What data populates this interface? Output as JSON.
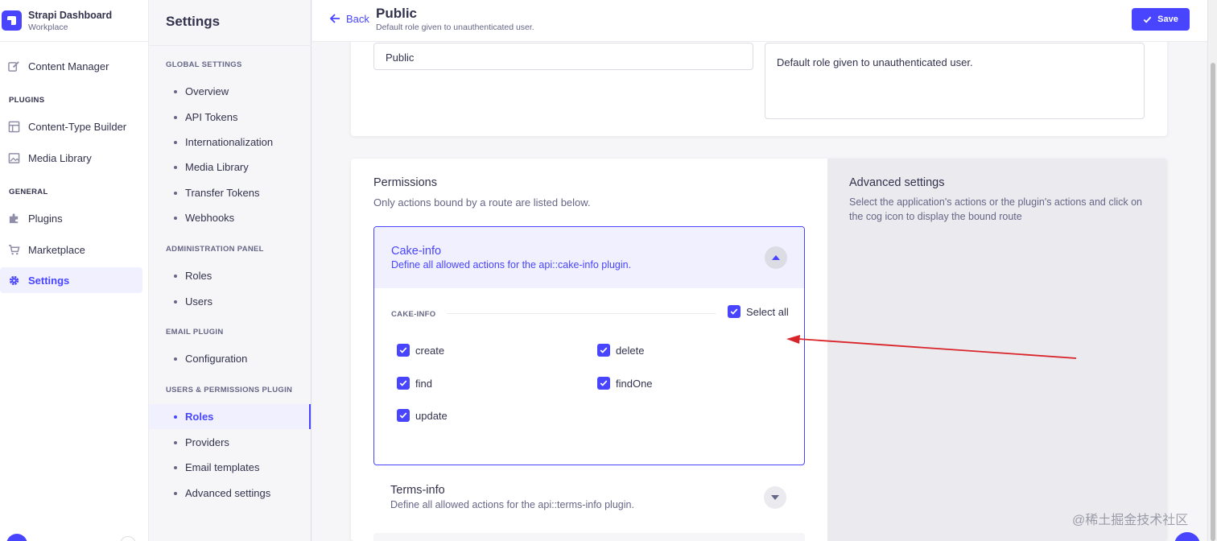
{
  "brand": {
    "title": "Strapi Dashboard",
    "subtitle": "Workplace"
  },
  "mainnav": {
    "content_manager": "Content Manager",
    "plugins_section": "PLUGINS",
    "content_type_builder": "Content-Type Builder",
    "media_library": "Media Library",
    "general_section": "GENERAL",
    "plugins": "Plugins",
    "marketplace": "Marketplace",
    "settings": "Settings"
  },
  "subnav": {
    "title": "Settings",
    "global_section": "GLOBAL SETTINGS",
    "global_items": [
      "Overview",
      "API Tokens",
      "Internationalization",
      "Media Library",
      "Transfer Tokens",
      "Webhooks"
    ],
    "admin_section": "ADMINISTRATION PANEL",
    "admin_items": [
      "Roles",
      "Users"
    ],
    "email_section": "EMAIL PLUGIN",
    "email_items": [
      "Configuration"
    ],
    "up_section": "USERS & PERMISSIONS PLUGIN",
    "up_items": [
      "Roles",
      "Providers",
      "Email templates",
      "Advanced settings"
    ]
  },
  "header": {
    "back_label": "Back",
    "title": "Public",
    "subtitle": "Default role given to unauthenticated user.",
    "save_label": "Save"
  },
  "role_form": {
    "name_value": "Public",
    "description_value": "Default role given to unauthenticated user."
  },
  "permissions": {
    "title": "Permissions",
    "subtitle": "Only actions bound by a route are listed below.",
    "open_group": {
      "title": "Cake-info",
      "subtitle": "Define all allowed actions for the api::cake-info plugin.",
      "section_label": "CAKE-INFO",
      "select_all_label": "Select all",
      "actions": [
        "create",
        "delete",
        "find",
        "findOne",
        "update"
      ]
    },
    "closed_group": {
      "title": "Terms-info",
      "subtitle": "Define all allowed actions for the api::terms-info plugin."
    }
  },
  "advanced": {
    "title": "Advanced settings",
    "text": "Select the application's actions or the plugin's actions and click on the cog icon to display the bound route"
  },
  "watermark": "@稀土掘金技术社区",
  "colors": {
    "primary": "#4945ff",
    "primary_light": "#f0f0ff",
    "text": "#32324d",
    "muted": "#666687",
    "annotation": "#d9252a"
  }
}
